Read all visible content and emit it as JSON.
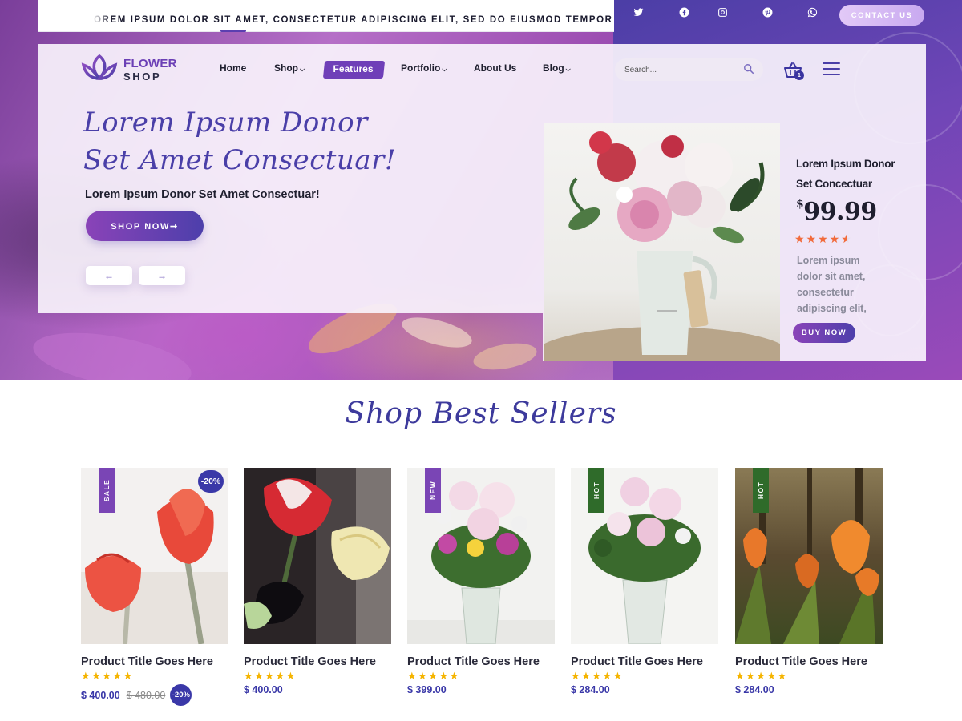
{
  "topbar": {
    "marquee": "OREM IPSUM DOLOR SIT AMET, CONSECTETUR ADIPISCING ELIT, SED DO EIUSMOD TEMPOR",
    "social_icons": [
      "twitter-icon",
      "facebook-icon",
      "instagram-icon",
      "pinterest-icon",
      "whatsapp-icon"
    ],
    "contact_label": "CONTACT US"
  },
  "logo": {
    "line1": "FLOWER",
    "line2": "SHOP"
  },
  "nav": {
    "items": [
      {
        "label": "Home",
        "dropdown": false
      },
      {
        "label": "Shop",
        "dropdown": true
      },
      {
        "label": "Features",
        "dropdown": false,
        "active": true
      },
      {
        "label": "Portfolio",
        "dropdown": true
      },
      {
        "label": "About Us",
        "dropdown": false
      },
      {
        "label": "Blog",
        "dropdown": true
      }
    ],
    "search_placeholder": "Search...",
    "cart_count": "1"
  },
  "hero": {
    "title_line1": "Lorem Ipsum Donor",
    "title_line2": "Set Amet Consectuar!",
    "subtitle": "Lorem Ipsum Donor Set Amet Consectuar!",
    "cta_label": "SHOP NOW➞",
    "prev_label": "←",
    "next_label": "→"
  },
  "featured": {
    "name_line1": "Lorem Ipsum Donor",
    "name_line2": "Set Concectuar",
    "currency": "$",
    "price": "99.99",
    "rating": 4.5,
    "stars": "★★★★★",
    "desc_lines": [
      "Lorem ipsum",
      "dolor sit amet,",
      "consectetur",
      " adipiscing elit,"
    ],
    "buy_label": "BUY NOW"
  },
  "best_sellers": {
    "title": "Shop Best Sellers",
    "products": [
      {
        "title": "Product Title Goes Here",
        "stars": "★★★★★",
        "price": "$ 400.00",
        "old_price": "$ 480.00",
        "discount": "-20%",
        "badge": "SALE",
        "badge_color": "#7a45b5"
      },
      {
        "title": "Product Title Goes Here",
        "stars": "★★★★★",
        "price": "$ 400.00",
        "old_price": "",
        "discount": "",
        "badge": "",
        "badge_color": ""
      },
      {
        "title": "Product Title Goes Here",
        "stars": "★★★★★",
        "price": "$ 399.00",
        "old_price": "",
        "discount": "",
        "badge": "NEW",
        "badge_color": "#7a45b5"
      },
      {
        "title": "Product Title Goes Here",
        "stars": "★★★★★",
        "price": "$ 284.00",
        "old_price": "",
        "discount": "",
        "badge": "HOT",
        "badge_color": "#2f6b2a"
      },
      {
        "title": "Product Title Goes Here",
        "stars": "★★★★★",
        "price": "$ 284.00",
        "old_price": "",
        "discount": "",
        "badge": "HOT",
        "badge_color": "#2f6b2a"
      }
    ]
  },
  "colors": {
    "primary": "#4a3fa8",
    "accent": "#7a45b5",
    "star_orange": "#f26a3b",
    "star_yellow": "#f5b400"
  }
}
